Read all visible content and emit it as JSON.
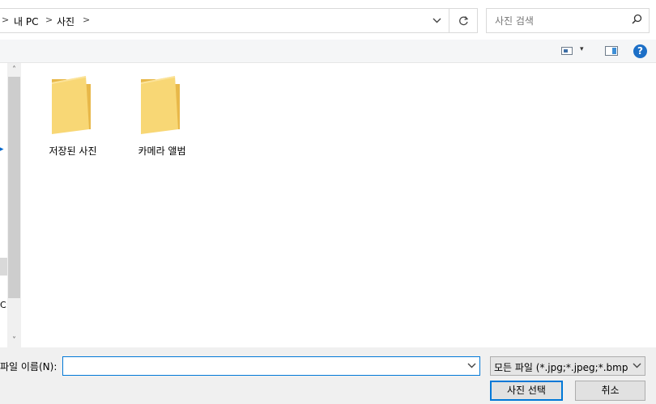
{
  "address": {
    "crumbs": [
      "내 PC",
      "사진"
    ],
    "separators": [
      ">",
      ">",
      ">"
    ],
    "dropdown_icon": "chevron-down-icon",
    "refresh_icon": "refresh-icon"
  },
  "search": {
    "placeholder": "사진 검색",
    "icon": "search-icon"
  },
  "toolbar": {
    "view_icon": "change-view-icon",
    "view_dropdown": "▾",
    "pane_icon": "preview-pane-icon",
    "help_label": "?"
  },
  "nav": {
    "partial_label": "C:)",
    "scroll_up": "˄",
    "scroll_down": "˅"
  },
  "folders": [
    {
      "name": "저장된 사진",
      "icon": "folder-icon"
    },
    {
      "name": "카메라 앨범",
      "icon": "folder-icon"
    }
  ],
  "footer": {
    "filename_label": "파일 이름(N):",
    "filename_value": "",
    "filetype_value": "모든 파일 (*.jpg;*.jpeg;*.bmp;*.c",
    "open_label": "사진 선택",
    "cancel_label": "취소"
  },
  "colors": {
    "accent": "#0078d7",
    "folder_yellow": "#f8d775",
    "help_blue": "#1c6fc7"
  }
}
